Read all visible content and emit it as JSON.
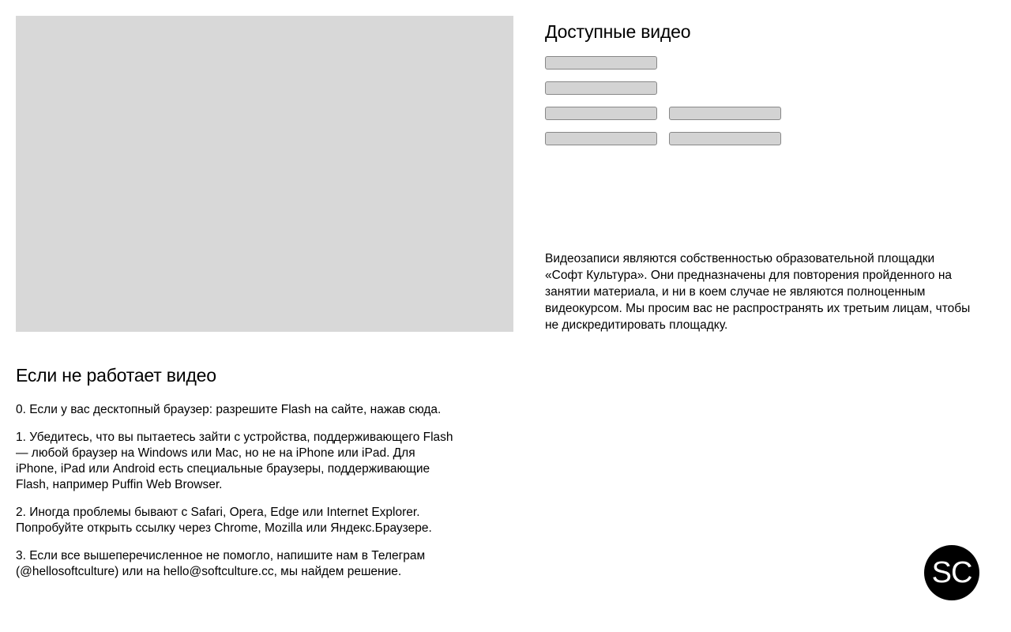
{
  "videos": {
    "title": "Доступные видео",
    "rows": [
      [
        ""
      ],
      [
        ""
      ],
      [
        "",
        ""
      ],
      [
        "",
        ""
      ]
    ]
  },
  "notice": "Видеозаписи являются собственностью образовательной площадки «Софт Культура». Они предназначены для повторения пройденного на занятии материала, и ни в коем случае не являются полноценным видеокурсом. Мы просим вас не распространять их третьим лицам, чтобы не дискредитировать площадку.",
  "troubleshoot": {
    "title": "Если не работает видео",
    "steps": [
      "0. Если у вас десктопный браузер: разрешите Flash на сайте, нажав сюда.",
      "1. Убедитесь, что вы пытаетесь зайти с устройства, поддерживающего Flash — любой браузер на Windows или Mac, но не на iPhone или iPad. Для iPhone, iPad или Android есть специальные браузеры, поддерживающие Flash, например Puffin Web Browser.",
      "2. Иногда проблемы бывают с Safari, Opera, Edge или Internet Explorer. Попробуйте открыть ссылку через Chrome, Mozilla или Яндекс.Браузере.",
      "3. Если все вышеперечисленное не помогло, напишите нам в Телеграм (@hellosoftculture) или на hello@softculture.cc, мы найдем решение."
    ]
  },
  "logo": {
    "text": "SC"
  },
  "colors": {
    "player_bg": "#d8d8d8",
    "button_bg": "#d3d3d3",
    "button_border": "#888888",
    "logo_bg": "#000000",
    "logo_fg": "#ffffff"
  }
}
